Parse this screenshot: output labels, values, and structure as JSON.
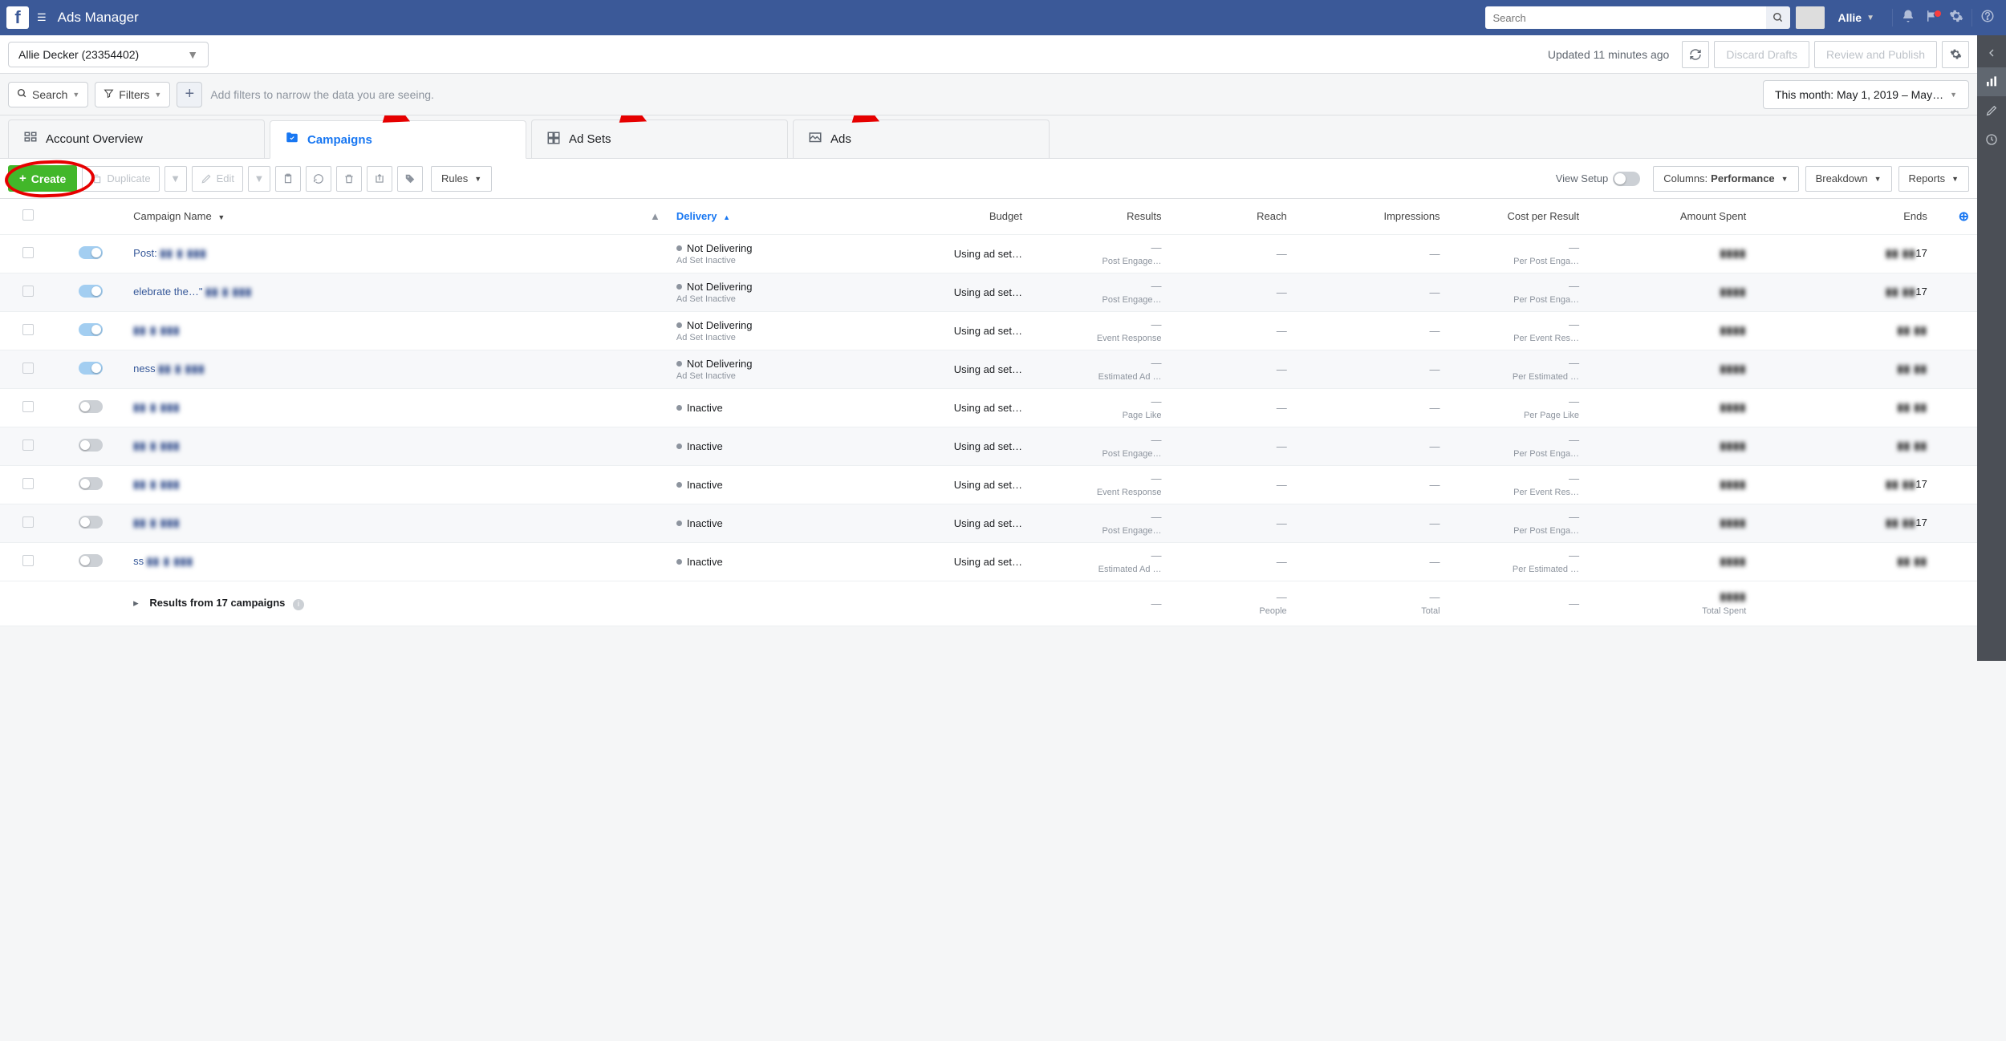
{
  "topnav": {
    "title": "Ads Manager",
    "search_placeholder": "Search",
    "user_name": "Allie"
  },
  "subheader": {
    "account": "Allie Decker (23354402)",
    "updated": "Updated 11 minutes ago",
    "discard": "Discard Drafts",
    "review": "Review and Publish"
  },
  "filterbar": {
    "search": "Search",
    "filters": "Filters",
    "hint": "Add filters to narrow the data you are seeing.",
    "date": "This month: May 1, 2019 – May…"
  },
  "tabs": {
    "overview": "Account Overview",
    "campaigns": "Campaigns",
    "adsets": "Ad Sets",
    "ads": "Ads"
  },
  "toolbar": {
    "create": "Create",
    "duplicate": "Duplicate",
    "edit": "Edit",
    "rules": "Rules",
    "view_setup": "View Setup",
    "columns_label": "Columns:",
    "columns_value": "Performance",
    "breakdown": "Breakdown",
    "reports": "Reports"
  },
  "columns": {
    "name": "Campaign Name",
    "delivery": "Delivery",
    "budget": "Budget",
    "results": "Results",
    "reach": "Reach",
    "impressions": "Impressions",
    "cpr": "Cost per Result",
    "spent": "Amount Spent",
    "ends": "Ends"
  },
  "rows": [
    {
      "toggle": "on",
      "name": "Post:",
      "delivery": "Not Delivering",
      "delivery_sub": "Ad Set Inactive",
      "budget": "Using ad set…",
      "results_sub": "Post Engage…",
      "cpr_sub": "Per Post Enga…",
      "ends_suffix": "17"
    },
    {
      "toggle": "on",
      "name": "elebrate the…\"",
      "delivery": "Not Delivering",
      "delivery_sub": "Ad Set Inactive",
      "budget": "Using ad set…",
      "results_sub": "Post Engage…",
      "cpr_sub": "Per Post Enga…",
      "ends_suffix": "17"
    },
    {
      "toggle": "on",
      "name": "",
      "delivery": "Not Delivering",
      "delivery_sub": "Ad Set Inactive",
      "budget": "Using ad set…",
      "results_sub": "Event Response",
      "cpr_sub": "Per Event Res…",
      "ends_suffix": ""
    },
    {
      "toggle": "on",
      "name": "ness",
      "delivery": "Not Delivering",
      "delivery_sub": "Ad Set Inactive",
      "budget": "Using ad set…",
      "results_sub": "Estimated Ad …",
      "cpr_sub": "Per Estimated …",
      "ends_suffix": ""
    },
    {
      "toggle": "off",
      "name": "",
      "delivery": "Inactive",
      "delivery_sub": "",
      "budget": "Using ad set…",
      "results_sub": "Page Like",
      "cpr_sub": "Per Page Like",
      "ends_suffix": ""
    },
    {
      "toggle": "off",
      "name": "",
      "delivery": "Inactive",
      "delivery_sub": "",
      "budget": "Using ad set…",
      "results_sub": "Post Engage…",
      "cpr_sub": "Per Post Enga…",
      "ends_suffix": ""
    },
    {
      "toggle": "off",
      "name": "",
      "delivery": "Inactive",
      "delivery_sub": "",
      "budget": "Using ad set…",
      "results_sub": "Event Response",
      "cpr_sub": "Per Event Res…",
      "ends_suffix": "17"
    },
    {
      "toggle": "off",
      "name": "",
      "delivery": "Inactive",
      "delivery_sub": "",
      "budget": "Using ad set…",
      "results_sub": "Post Engage…",
      "cpr_sub": "Per Post Enga…",
      "ends_suffix": "17"
    },
    {
      "toggle": "off",
      "name": "ss",
      "delivery": "Inactive",
      "delivery_sub": "",
      "budget": "Using ad set…",
      "results_sub": "Estimated Ad …",
      "cpr_sub": "Per Estimated …",
      "ends_suffix": ""
    }
  ],
  "footer": {
    "results_from": "Results from 17 campaigns",
    "people": "People",
    "total": "Total",
    "total_spent": "Total Spent"
  }
}
